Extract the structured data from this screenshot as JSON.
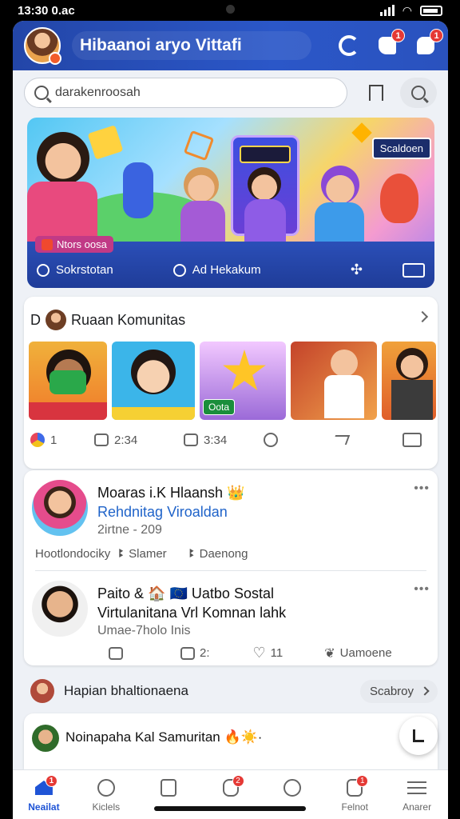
{
  "status_bar": {
    "time": "13:30 0.ac"
  },
  "header": {
    "title": "Hibaanoi aryo Vittafi",
    "badges": {
      "chat": "1",
      "profile": "1"
    }
  },
  "search": {
    "placeholder": "darakenroosah"
  },
  "hero": {
    "tag": "Scaldoen",
    "badge": "Ntors oosa",
    "footer": {
      "left": "Sokrstotan",
      "middle": "Ad Hekakum"
    }
  },
  "community": {
    "prefix": "D",
    "title": "Ruaan Komunitas",
    "thumb_labels": [
      "Oota"
    ],
    "stats": {
      "count": "1",
      "likes": "2:34",
      "comments": "3:34"
    }
  },
  "posts": [
    {
      "title": "Moaras i.K Hlaansh",
      "emoji": "👑",
      "subtitle": "Rehdnitag Viroaldan",
      "meta": "2irtne - 209",
      "actions": [
        "Hootlondociky",
        "Slamer",
        "Daenong"
      ]
    },
    {
      "title": "Paito",
      "emoji": "& 🏠 🇪🇺",
      "title_rest": "Uatbo Sostal",
      "subtitle": "Virtulanitana Vrl Komnan lahk",
      "meta": "Umae-7holo Inis",
      "actions": [
        "2:",
        "11",
        "Uamoene"
      ]
    }
  ],
  "section": {
    "title": "Hapian bhaltionaena",
    "pill": "Scabroy"
  },
  "post3": {
    "title": "Noinapaha Kal Samuritan",
    "emoji": "🔥☀️·"
  },
  "bottom_nav": [
    {
      "label": "Neailat",
      "badge": "1"
    },
    {
      "label": "Kiclels",
      "badge": ""
    },
    {
      "label": "",
      "badge": ""
    },
    {
      "label": "",
      "badge": "2"
    },
    {
      "label": "",
      "badge": ""
    },
    {
      "label": "Felnot",
      "badge": "1"
    },
    {
      "label": "Anarer",
      "badge": ""
    }
  ],
  "colors": {
    "brand": "#2346a8",
    "accent": "#1f54d6",
    "badge": "#e53935"
  },
  "icons": [
    "loading-ring-icon",
    "chat-icon",
    "profile-icon",
    "search-icon",
    "bookmark-icon",
    "home-icon",
    "compass-icon",
    "menu-icon",
    "edit-icon"
  ]
}
